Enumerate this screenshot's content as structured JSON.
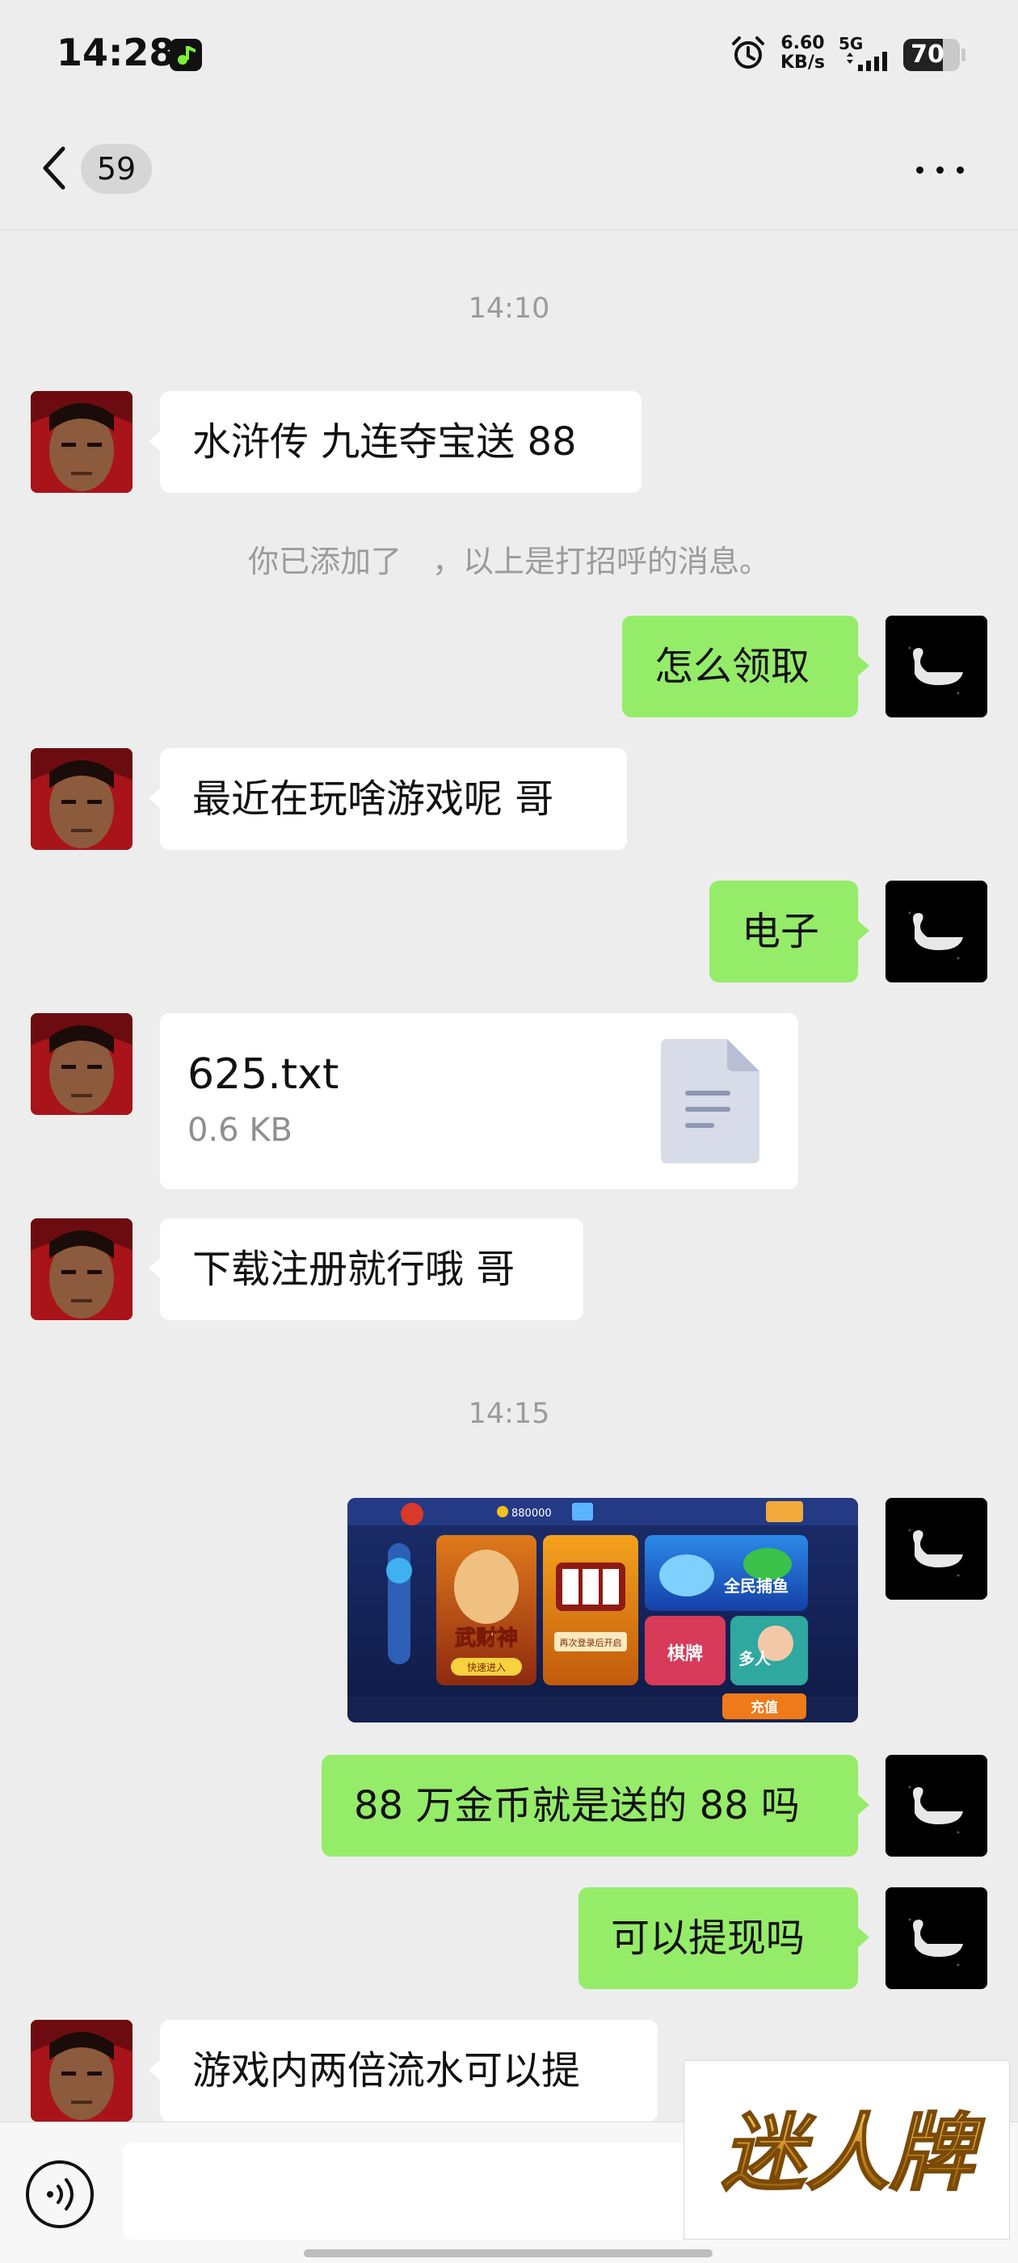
{
  "status_bar": {
    "time": "14:28",
    "net_speed_value": "6.60",
    "net_speed_unit": "KB/s",
    "network": "5G",
    "battery": "70",
    "battery_level": 0.7,
    "icons": [
      "music-app-icon",
      "alarm-icon",
      "signal-icon",
      "battery-icon"
    ]
  },
  "header": {
    "unread_count": "59",
    "icons": [
      "back-chevron-icon",
      "more-icon"
    ]
  },
  "chat": {
    "timestamp_1": "14:10",
    "msg_1": "水浒传 九连夺宝送 88",
    "system_note": "你已添加了　，以上是打招呼的消息。",
    "msg_2": "怎么领取",
    "msg_3": "最近在玩啥游戏呢 哥",
    "msg_4": "电子",
    "file": {
      "name": "625.txt",
      "size": "0.6 KB",
      "icon": "document-icon"
    },
    "msg_5": "下载注册就行哦 哥",
    "timestamp_2": "14:15",
    "image": {
      "balance": "880000",
      "tile_1": "武财神",
      "tile_1_button": "快速进入",
      "tile_2_label": "再次登录后开启",
      "tile_3": "全民捕鱼",
      "tile_4": "棋牌",
      "tile_5": "多人",
      "recharge": "充值"
    },
    "msg_6": "88 万金币就是送的 88 吗",
    "msg_7": "可以提现吗",
    "msg_8": "游戏内两倍流水可以提"
  },
  "watermark": {
    "text": "迷人牌"
  },
  "colors": {
    "background": "#ededed",
    "outgoing_bubble": "#95ec69",
    "incoming_bubble": "#ffffff",
    "timestamp_text": "#9b9b9b"
  }
}
